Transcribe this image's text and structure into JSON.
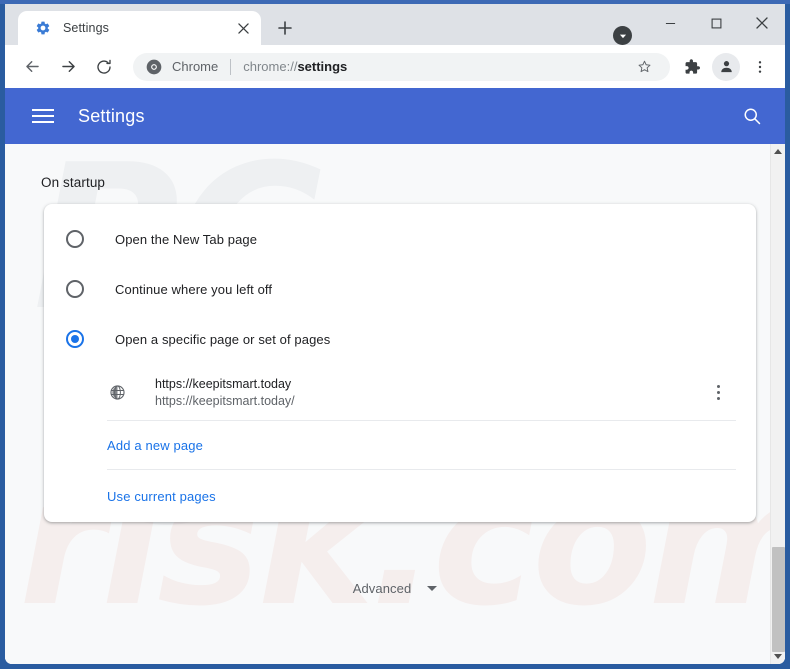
{
  "browser": {
    "tab": {
      "title": "Settings",
      "favicon_icon": "gear-icon",
      "close_icon": "close-icon"
    },
    "new_tab_icon": "plus-icon",
    "window_controls": {
      "minimize_icon": "minimize-icon",
      "maximize_icon": "maximize-icon",
      "close_icon": "close-icon",
      "download_icon": "download-arrow-icon"
    },
    "toolbar": {
      "back_icon": "back-arrow-icon",
      "forward_icon": "forward-arrow-icon",
      "reload_icon": "reload-icon",
      "omnibox": {
        "chrome_icon": "chrome-logo-icon",
        "chrome_label": "Chrome",
        "url_prefix": "chrome://",
        "url_path": "settings",
        "full_url": "chrome://settings",
        "star_icon": "bookmark-star-icon"
      },
      "extensions_icon": "puzzle-piece-icon",
      "profile_icon": "account-avatar-icon",
      "menu_icon": "three-dot-menu-icon"
    }
  },
  "settings_page": {
    "header": {
      "menu_icon": "hamburger-menu-icon",
      "title": "Settings",
      "search_icon": "search-icon"
    },
    "section": {
      "label": "On startup",
      "options": [
        {
          "label": "Open the New Tab page",
          "selected": false
        },
        {
          "label": "Continue where you left off",
          "selected": false
        },
        {
          "label": "Open a specific page or set of pages",
          "selected": true
        }
      ],
      "startup_pages": [
        {
          "icon": "globe-icon",
          "title": "https://keepitsmart.today",
          "url": "https://keepitsmart.today/",
          "menu_icon": "three-dot-menu-icon"
        }
      ],
      "actions": [
        {
          "label": "Add a new page"
        },
        {
          "label": "Use current pages"
        }
      ]
    },
    "advanced": {
      "label": "Advanced",
      "expand_icon": "chevron-down-icon"
    },
    "scrollbar": {
      "up_icon": "scroll-up-arrow-icon",
      "down_icon": "scroll-down-arrow-icon"
    }
  },
  "watermark": {
    "line1": "PC",
    "line2": "risk.com"
  },
  "colors": {
    "settings_header_blue": "#4367d1",
    "accent_blue": "#1a73e8",
    "window_frame_blue": "#2a5ca0",
    "tabstrip_gray": "#dee1e6",
    "page_background": "#f8f9fa"
  }
}
